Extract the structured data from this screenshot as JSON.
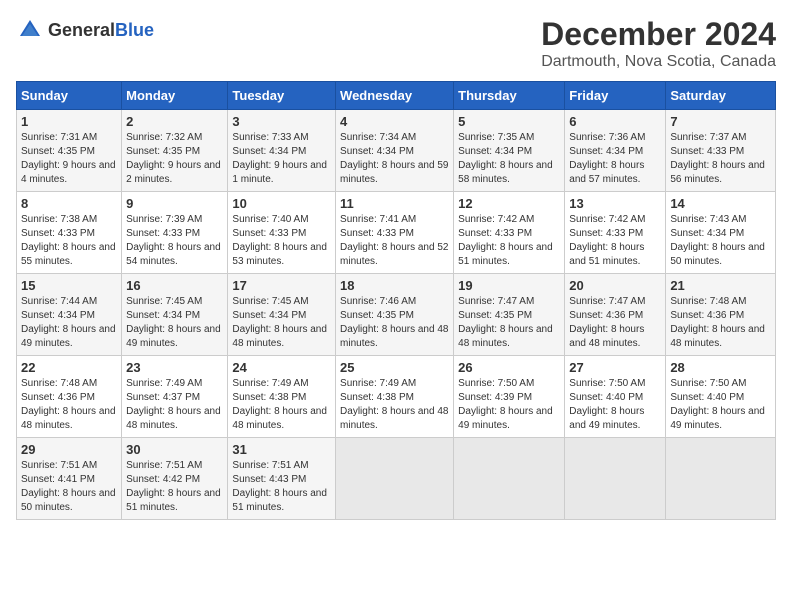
{
  "header": {
    "logo_general": "General",
    "logo_blue": "Blue",
    "main_title": "December 2024",
    "subtitle": "Dartmouth, Nova Scotia, Canada"
  },
  "weekdays": [
    "Sunday",
    "Monday",
    "Tuesday",
    "Wednesday",
    "Thursday",
    "Friday",
    "Saturday"
  ],
  "weeks": [
    [
      {
        "day": "1",
        "sunrise": "7:31 AM",
        "sunset": "4:35 PM",
        "daylight": "9 hours and 4 minutes."
      },
      {
        "day": "2",
        "sunrise": "7:32 AM",
        "sunset": "4:35 PM",
        "daylight": "9 hours and 2 minutes."
      },
      {
        "day": "3",
        "sunrise": "7:33 AM",
        "sunset": "4:34 PM",
        "daylight": "9 hours and 1 minute."
      },
      {
        "day": "4",
        "sunrise": "7:34 AM",
        "sunset": "4:34 PM",
        "daylight": "8 hours and 59 minutes."
      },
      {
        "day": "5",
        "sunrise": "7:35 AM",
        "sunset": "4:34 PM",
        "daylight": "8 hours and 58 minutes."
      },
      {
        "day": "6",
        "sunrise": "7:36 AM",
        "sunset": "4:34 PM",
        "daylight": "8 hours and 57 minutes."
      },
      {
        "day": "7",
        "sunrise": "7:37 AM",
        "sunset": "4:33 PM",
        "daylight": "8 hours and 56 minutes."
      }
    ],
    [
      {
        "day": "8",
        "sunrise": "7:38 AM",
        "sunset": "4:33 PM",
        "daylight": "8 hours and 55 minutes."
      },
      {
        "day": "9",
        "sunrise": "7:39 AM",
        "sunset": "4:33 PM",
        "daylight": "8 hours and 54 minutes."
      },
      {
        "day": "10",
        "sunrise": "7:40 AM",
        "sunset": "4:33 PM",
        "daylight": "8 hours and 53 minutes."
      },
      {
        "day": "11",
        "sunrise": "7:41 AM",
        "sunset": "4:33 PM",
        "daylight": "8 hours and 52 minutes."
      },
      {
        "day": "12",
        "sunrise": "7:42 AM",
        "sunset": "4:33 PM",
        "daylight": "8 hours and 51 minutes."
      },
      {
        "day": "13",
        "sunrise": "7:42 AM",
        "sunset": "4:33 PM",
        "daylight": "8 hours and 51 minutes."
      },
      {
        "day": "14",
        "sunrise": "7:43 AM",
        "sunset": "4:34 PM",
        "daylight": "8 hours and 50 minutes."
      }
    ],
    [
      {
        "day": "15",
        "sunrise": "7:44 AM",
        "sunset": "4:34 PM",
        "daylight": "8 hours and 49 minutes."
      },
      {
        "day": "16",
        "sunrise": "7:45 AM",
        "sunset": "4:34 PM",
        "daylight": "8 hours and 49 minutes."
      },
      {
        "day": "17",
        "sunrise": "7:45 AM",
        "sunset": "4:34 PM",
        "daylight": "8 hours and 48 minutes."
      },
      {
        "day": "18",
        "sunrise": "7:46 AM",
        "sunset": "4:35 PM",
        "daylight": "8 hours and 48 minutes."
      },
      {
        "day": "19",
        "sunrise": "7:47 AM",
        "sunset": "4:35 PM",
        "daylight": "8 hours and 48 minutes."
      },
      {
        "day": "20",
        "sunrise": "7:47 AM",
        "sunset": "4:36 PM",
        "daylight": "8 hours and 48 minutes."
      },
      {
        "day": "21",
        "sunrise": "7:48 AM",
        "sunset": "4:36 PM",
        "daylight": "8 hours and 48 minutes."
      }
    ],
    [
      {
        "day": "22",
        "sunrise": "7:48 AM",
        "sunset": "4:36 PM",
        "daylight": "8 hours and 48 minutes."
      },
      {
        "day": "23",
        "sunrise": "7:49 AM",
        "sunset": "4:37 PM",
        "daylight": "8 hours and 48 minutes."
      },
      {
        "day": "24",
        "sunrise": "7:49 AM",
        "sunset": "4:38 PM",
        "daylight": "8 hours and 48 minutes."
      },
      {
        "day": "25",
        "sunrise": "7:49 AM",
        "sunset": "4:38 PM",
        "daylight": "8 hours and 48 minutes."
      },
      {
        "day": "26",
        "sunrise": "7:50 AM",
        "sunset": "4:39 PM",
        "daylight": "8 hours and 49 minutes."
      },
      {
        "day": "27",
        "sunrise": "7:50 AM",
        "sunset": "4:40 PM",
        "daylight": "8 hours and 49 minutes."
      },
      {
        "day": "28",
        "sunrise": "7:50 AM",
        "sunset": "4:40 PM",
        "daylight": "8 hours and 49 minutes."
      }
    ],
    [
      {
        "day": "29",
        "sunrise": "7:51 AM",
        "sunset": "4:41 PM",
        "daylight": "8 hours and 50 minutes."
      },
      {
        "day": "30",
        "sunrise": "7:51 AM",
        "sunset": "4:42 PM",
        "daylight": "8 hours and 51 minutes."
      },
      {
        "day": "31",
        "sunrise": "7:51 AM",
        "sunset": "4:43 PM",
        "daylight": "8 hours and 51 minutes."
      },
      {
        "day": "",
        "sunrise": "",
        "sunset": "",
        "daylight": ""
      },
      {
        "day": "",
        "sunrise": "",
        "sunset": "",
        "daylight": ""
      },
      {
        "day": "",
        "sunrise": "",
        "sunset": "",
        "daylight": ""
      },
      {
        "day": "",
        "sunrise": "",
        "sunset": "",
        "daylight": ""
      }
    ]
  ]
}
